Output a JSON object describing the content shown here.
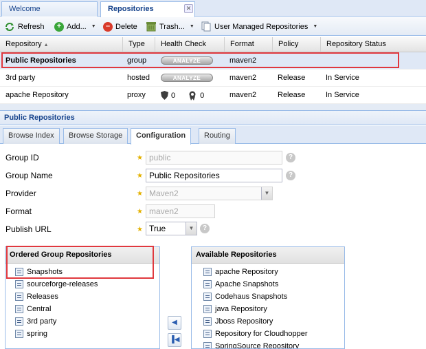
{
  "tabs": [
    {
      "label": "Welcome",
      "active": false
    },
    {
      "label": "Repositories",
      "active": true,
      "close_glyph": "✕"
    }
  ],
  "toolbar": {
    "refresh": "Refresh",
    "add": "Add...",
    "delete": "Delete",
    "trash": "Trash...",
    "user_managed": "User Managed Repositories"
  },
  "grid": {
    "columns": [
      "Repository",
      "Type",
      "Health Check",
      "Format",
      "Policy",
      "Repository Status"
    ],
    "sort_indicator": "▲",
    "rows": [
      {
        "name": "Public Repositories",
        "type": "group",
        "health": "ANALYZE",
        "format": "maven2",
        "policy": "",
        "status": "",
        "selected": true
      },
      {
        "name": "3rd party",
        "type": "hosted",
        "health": "ANALYZE",
        "format": "maven2",
        "policy": "Release",
        "status": "In Service",
        "selected": false
      },
      {
        "name": "apache Repository",
        "type": "proxy",
        "health_counts": [
          "0",
          "0"
        ],
        "format": "maven2",
        "policy": "Release",
        "status": "In Service",
        "selected": false
      }
    ]
  },
  "detail": {
    "title": "Public Repositories",
    "tabs": [
      "Browse Index",
      "Browse Storage",
      "Configuration",
      "Routing"
    ],
    "active_tab": "Configuration"
  },
  "form": {
    "group_id": {
      "label": "Group ID",
      "value": "public"
    },
    "group_name": {
      "label": "Group Name",
      "value": "Public Repositories"
    },
    "provider": {
      "label": "Provider",
      "value": "Maven2"
    },
    "format": {
      "label": "Format",
      "value": "maven2"
    },
    "publish_url": {
      "label": "Publish URL",
      "value": "True"
    }
  },
  "ordered": {
    "title": "Ordered Group Repositories",
    "items": [
      "Snapshots",
      "sourceforge-releases",
      "Releases",
      "Central",
      "3rd party",
      "spring"
    ]
  },
  "available": {
    "title": "Available Repositories",
    "items": [
      "apache Repository",
      "Apache Snapshots",
      "Codehaus Snapshots",
      "java Repository",
      "Jboss Repository",
      "Repository for Cloudhopper",
      "SpringSource Repository"
    ]
  },
  "colors": {
    "highlight_red": "#e0383e",
    "accent_blue": "#99bbe8",
    "header_blue": "#15428b"
  }
}
